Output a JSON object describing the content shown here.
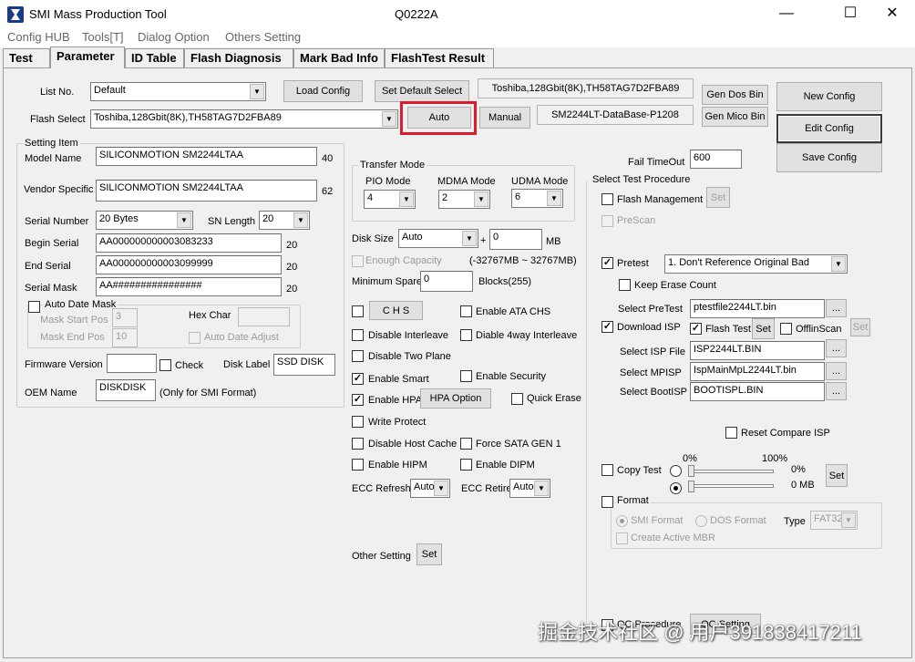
{
  "window": {
    "title": "SMI Mass Production Tool",
    "subtitle": "Q0222A",
    "min": "—",
    "max": "☐",
    "close": "✕"
  },
  "menu": [
    "Config HUB",
    "Tools[T]",
    "Dialog Option",
    "Others Setting"
  ],
  "tabs": [
    "Test",
    "Parameter",
    "ID Table",
    "Flash Diagnosis",
    "Mark Bad Info",
    "FlashTest Result"
  ],
  "top": {
    "list_no_label": "List No.",
    "list_no_value": "Default",
    "load_config": "Load Config",
    "set_default_select": "Set Default Select",
    "flash_info": "Toshiba,128Gbit(8K),TH58TAG7D2FBA89",
    "gen_dos_bin": "Gen Dos Bin",
    "new_config": "New Config",
    "flash_select_label": "Flash Select",
    "flash_select_value": "Toshiba,128Gbit(8K),TH58TAG7D2FBA89",
    "auto": "Auto",
    "manual": "Manual",
    "database": "SM2244LT-DataBase-P1208",
    "gen_mico_bin": "Gen Mico Bin",
    "edit_config": "Edit Config",
    "save_config": "Save Config",
    "fail_timeout_label": "Fail TimeOut",
    "fail_timeout_value": "600"
  },
  "setting": {
    "legend": "Setting Item",
    "model_name_label": "Model Name",
    "model_name": "SILICONMOTION SM2244LTAA",
    "model_len": "40",
    "vendor_label": "Vendor Specific",
    "vendor": "SILICONMOTION SM2244LTAA",
    "vendor_len": "62",
    "serial_number_label": "Serial Number",
    "serial_number": "20 Bytes",
    "sn_length_label": "SN Length",
    "sn_length": "20",
    "begin_serial_label": "Begin Serial",
    "begin_serial": "AA000000000003083233",
    "begin_len": "20",
    "end_serial_label": "End Serial",
    "end_serial": "AA000000000003099999",
    "end_len": "20",
    "serial_mask_label": "Serial Mask",
    "serial_mask": "AA################",
    "mask_len": "20",
    "auto_date_mask": "Auto Date Mask",
    "mask_start_label": "Mask Start Pos",
    "mask_start": "3",
    "mask_end_label": "Mask End Pos",
    "mask_end": "10",
    "hex_char_label": "Hex Char",
    "auto_date_adjust": "Auto Date Adjust",
    "firmware_label": "Firmware Version",
    "check": "Check",
    "disk_label_label": "Disk Label",
    "disk_label": "SSD DISK",
    "oem_label": "OEM Name",
    "oem": "DISKDISK",
    "oem_note": "(Only for SMI Format)"
  },
  "transfer": {
    "legend": "Transfer Mode",
    "pio_label": "PIO Mode",
    "pio": "4",
    "mdma_label": "MDMA Mode",
    "mdma": "2",
    "udma_label": "UDMA Mode",
    "udma": "6"
  },
  "mid": {
    "disk_size_label": "Disk Size",
    "disk_size": "Auto",
    "plus": "+",
    "disk_extra": "0",
    "mb": "MB",
    "enough_capacity": "Enough Capacity",
    "capacity_range": "(-32767MB ~ 32767MB)",
    "min_spare_label": "Minimum Spare",
    "min_spare": "0",
    "blocks": "Blocks(255)",
    "chs": "C H S",
    "enable_ata_chs": "Enable ATA CHS",
    "disable_interleave": "Disable Interleave",
    "diable_4way": "Diable 4way Interleave",
    "disable_two_plane": "Disable Two Plane",
    "enable_smart": "Enable Smart",
    "enable_security": "Enable Security",
    "enable_hpa": "Enable HPA",
    "hpa_option": "HPA Option",
    "quick_erase": "Quick Erase",
    "write_protect": "Write Protect",
    "disable_host_cache": "Disable Host Cache",
    "force_sata_gen1": "Force SATA GEN 1",
    "enable_hipm": "Enable HIPM",
    "enable_dipm": "Enable DIPM",
    "ecc_refresh_label": "ECC Refresh",
    "ecc_refresh": "Auto",
    "ecc_retire_label": "ECC Retire",
    "ecc_retire": "Auto",
    "other_setting": "Other Setting",
    "set": "Set"
  },
  "right": {
    "legend": "Select Test Procedure",
    "flash_management": "Flash Management",
    "set": "Set",
    "prescan": "PreScan",
    "pretest": "Pretest",
    "pretest_option": "1. Don't Reference Original Bad",
    "keep_erase_count": "Keep Erase Count",
    "select_pretest_label": "Select PreTest",
    "pretest_file": "ptestfile2244LT.bin",
    "browse": "...",
    "download_isp": "Download ISP",
    "flash_test": "Flash Test",
    "offline_scan": "OfflinScan",
    "select_isp_label": "Select ISP File",
    "isp_file": "ISP2244LT.BIN",
    "select_mpisp_label": "Select MPISP",
    "mpisp_file": "IspMainMpL2244LT.bin",
    "select_bootisp_label": "Select BootISP",
    "bootisp_file": "BOOTISPL.BIN",
    "reset_compare_isp": "Reset Compare ISP",
    "copy_test": "Copy Test",
    "pct0": "0%",
    "pct100": "100%",
    "pct_value": "0%",
    "mb_value": "0 MB",
    "format": "Format",
    "smi_format": "SMI Format",
    "dos_format": "DOS Format",
    "type_label": "Type",
    "type": "FAT32",
    "create_active_mbr": "Create Active MBR",
    "qc_procedure": "QC Procedure",
    "qc_setting": "QC Setting"
  },
  "watermark": "掘金技术社区 @ 用户391838417211"
}
